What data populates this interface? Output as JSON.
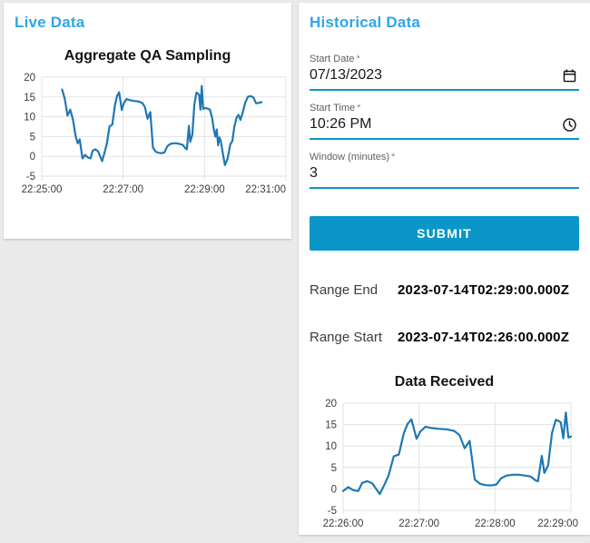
{
  "colors": {
    "heading_blue": "#2fa6e8",
    "button_blue": "#0a96c9",
    "underline_blue": "#0a96c9",
    "line_blue": "#1f77b4",
    "grid_gray": "#e3e3e3",
    "card_white": "#ffffff",
    "page_background": "#eaeaea"
  },
  "live_panel": {
    "title": "Live Data"
  },
  "historical_panel": {
    "title": "Historical Data",
    "fields": [
      {
        "label": "Start Date",
        "required_marker": "*",
        "value": "07/13/2023",
        "icon": "calendar-icon"
      },
      {
        "label": "Start Time",
        "required_marker": "*",
        "value": "10:26 PM",
        "icon": "clock-icon"
      },
      {
        "label": "Window (minutes)",
        "required_marker": "*",
        "value": "3",
        "icon": null
      }
    ],
    "submit_label": "SUBMIT",
    "range_end_label": "Range End",
    "range_end_value": "2023-07-14T02:29:00.000Z",
    "range_start_label": "Range Start",
    "range_start_value": "2023-07-14T02:26:00.000Z"
  },
  "chart_data": [
    {
      "type": "line",
      "title": "Aggregate QA Sampling",
      "xlabel": "",
      "ylabel": "",
      "x_unit": "seconds after 22:25:00",
      "xlim": [
        0,
        360
      ],
      "ylim": [
        -5,
        20
      ],
      "yticks": [
        -5,
        0,
        5,
        10,
        15,
        20
      ],
      "xticks": [
        {
          "t": 0,
          "label": "22:25:00"
        },
        {
          "t": 120,
          "label": "22:27:00"
        },
        {
          "t": 240,
          "label": "22:29:00"
        },
        {
          "t": 360,
          "label": "22:31:00"
        }
      ],
      "grid": true,
      "legend": "none",
      "points": [
        [
          30,
          16.9
        ],
        [
          34,
          14.5
        ],
        [
          38,
          10.3
        ],
        [
          42,
          11.8
        ],
        [
          46,
          9.3
        ],
        [
          50,
          5.0
        ],
        [
          53,
          3.3
        ],
        [
          56,
          4.3
        ],
        [
          60,
          -0.5
        ],
        [
          64,
          0.4
        ],
        [
          68,
          -0.3
        ],
        [
          72,
          -0.5
        ],
        [
          75,
          1.4
        ],
        [
          79,
          1.8
        ],
        [
          83,
          1.3
        ],
        [
          89,
          -1.2
        ],
        [
          93,
          1.2
        ],
        [
          96,
          3.2
        ],
        [
          100,
          7.6
        ],
        [
          104,
          8.0
        ],
        [
          108,
          13.0
        ],
        [
          111,
          15.2
        ],
        [
          114,
          16.2
        ],
        [
          118,
          11.7
        ],
        [
          121,
          13.4
        ],
        [
          125,
          14.5
        ],
        [
          130,
          14.2
        ],
        [
          136,
          14.0
        ],
        [
          142,
          13.9
        ],
        [
          148,
          13.5
        ],
        [
          152,
          12.5
        ],
        [
          156,
          9.5
        ],
        [
          160,
          11.2
        ],
        [
          164,
          2.2
        ],
        [
          168,
          1.2
        ],
        [
          172,
          0.9
        ],
        [
          177,
          0.8
        ],
        [
          181,
          1.0
        ],
        [
          185,
          2.5
        ],
        [
          189,
          3.1
        ],
        [
          194,
          3.3
        ],
        [
          199,
          3.3
        ],
        [
          204,
          3.1
        ],
        [
          208,
          2.9
        ],
        [
          212,
          2.0
        ],
        [
          214,
          1.8
        ],
        [
          217,
          7.7
        ],
        [
          219,
          3.7
        ],
        [
          222,
          5.5
        ],
        [
          225,
          13.0
        ],
        [
          228,
          16.1
        ],
        [
          230,
          15.9
        ],
        [
          232,
          15.5
        ],
        [
          234,
          11.8
        ],
        [
          236,
          17.8
        ],
        [
          238,
          12.0
        ],
        [
          240,
          12.2
        ],
        [
          244,
          12.1
        ],
        [
          248,
          11.8
        ],
        [
          251,
          9.8
        ],
        [
          254,
          6.5
        ],
        [
          256,
          5.0
        ],
        [
          258,
          6.8
        ],
        [
          260,
          2.8
        ],
        [
          262,
          4.8
        ],
        [
          264,
          3.8
        ],
        [
          267,
          0.7
        ],
        [
          270,
          -2.2
        ],
        [
          274,
          -0.6
        ],
        [
          278,
          3.0
        ],
        [
          281,
          3.9
        ],
        [
          284,
          7.5
        ],
        [
          287,
          9.7
        ],
        [
          290,
          10.5
        ],
        [
          293,
          9.2
        ],
        [
          296,
          10.9
        ],
        [
          300,
          13.6
        ],
        [
          304,
          15.1
        ],
        [
          308,
          15.2
        ],
        [
          312,
          14.9
        ],
        [
          316,
          13.4
        ],
        [
          320,
          13.5
        ],
        [
          324,
          13.7
        ]
      ]
    },
    {
      "type": "line",
      "title": "Data Received",
      "xlabel": "",
      "ylabel": "",
      "x_unit": "seconds after 22:26:00",
      "xlim": [
        0,
        180
      ],
      "ylim": [
        -5,
        20
      ],
      "yticks": [
        -5,
        0,
        5,
        10,
        15,
        20
      ],
      "xticks": [
        {
          "t": 0,
          "label": "22:26:00"
        },
        {
          "t": 60,
          "label": "22:27:00"
        },
        {
          "t": 120,
          "label": "22:28:00"
        },
        {
          "t": 180,
          "label": "22:29:00"
        }
      ],
      "grid": true,
      "legend": "none",
      "points": [
        [
          0,
          -0.5
        ],
        [
          4,
          0.4
        ],
        [
          8,
          -0.3
        ],
        [
          12,
          -0.5
        ],
        [
          15,
          1.4
        ],
        [
          19,
          1.8
        ],
        [
          23,
          1.3
        ],
        [
          29,
          -1.2
        ],
        [
          33,
          1.2
        ],
        [
          36,
          3.2
        ],
        [
          40,
          7.6
        ],
        [
          44,
          8.0
        ],
        [
          48,
          13.0
        ],
        [
          51,
          15.2
        ],
        [
          54,
          16.2
        ],
        [
          58,
          11.7
        ],
        [
          61,
          13.4
        ],
        [
          65,
          14.5
        ],
        [
          70,
          14.2
        ],
        [
          76,
          14.0
        ],
        [
          82,
          13.9
        ],
        [
          88,
          13.5
        ],
        [
          92,
          12.5
        ],
        [
          96,
          9.5
        ],
        [
          100,
          11.2
        ],
        [
          104,
          2.2
        ],
        [
          108,
          1.2
        ],
        [
          112,
          0.9
        ],
        [
          117,
          0.8
        ],
        [
          121,
          1.0
        ],
        [
          125,
          2.5
        ],
        [
          129,
          3.1
        ],
        [
          134,
          3.3
        ],
        [
          139,
          3.3
        ],
        [
          144,
          3.1
        ],
        [
          148,
          2.9
        ],
        [
          152,
          2.0
        ],
        [
          154,
          1.8
        ],
        [
          157,
          7.7
        ],
        [
          159,
          3.7
        ],
        [
          162,
          5.5
        ],
        [
          165,
          13.0
        ],
        [
          168,
          16.1
        ],
        [
          170,
          15.9
        ],
        [
          172,
          15.5
        ],
        [
          174,
          11.8
        ],
        [
          176,
          17.8
        ],
        [
          178,
          12.0
        ],
        [
          180,
          12.2
        ]
      ]
    }
  ]
}
